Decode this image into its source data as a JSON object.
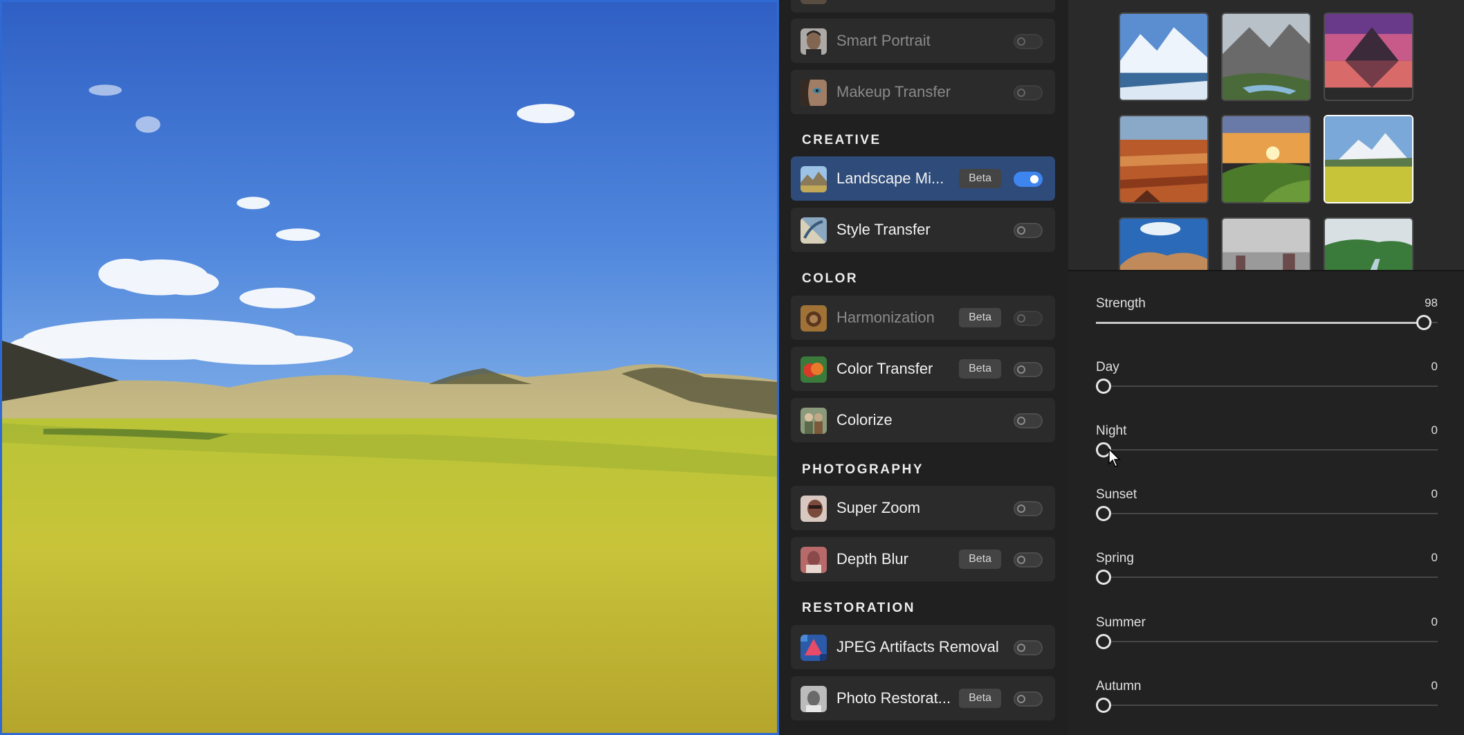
{
  "sections": {
    "creative": "CREATIVE",
    "color": "COLOR",
    "photography": "PHOTOGRAPHY",
    "restoration": "RESTORATION"
  },
  "filters": {
    "top_partial": {
      "label": "",
      "enabled": false
    },
    "smart_portrait": {
      "label": "Smart Portrait",
      "enabled": false
    },
    "makeup_transfer": {
      "label": "Makeup Transfer",
      "enabled": false
    },
    "landscape_mixer": {
      "label": "Landscape Mi...",
      "badge": "Beta",
      "enabled": true
    },
    "style_transfer": {
      "label": "Style Transfer",
      "enabled": false
    },
    "harmonization": {
      "label": "Harmonization",
      "badge": "Beta",
      "enabled": false
    },
    "color_transfer": {
      "label": "Color Transfer",
      "badge": "Beta",
      "enabled": false
    },
    "colorize": {
      "label": "Colorize",
      "enabled": false
    },
    "super_zoom": {
      "label": "Super Zoom",
      "enabled": false
    },
    "depth_blur": {
      "label": "Depth Blur",
      "badge": "Beta",
      "enabled": false
    },
    "jpeg_artifacts_removal": {
      "label": "JPEG Artifacts Removal",
      "enabled": false
    },
    "photo_restoration": {
      "label": "Photo Restorat...",
      "badge": "Beta",
      "enabled": false
    }
  },
  "gallery": {
    "selected_index": 5,
    "thumbnails": [
      "snowy-lake",
      "mountain-valley",
      "matterhorn-sunset",
      "canyon",
      "sunset-hills",
      "green-meadow-mountains",
      "rock-cliffs",
      "misty-rocks",
      "river-valley"
    ]
  },
  "sliders": {
    "strength": {
      "label": "Strength",
      "value": "98",
      "fraction": 0.98
    },
    "day": {
      "label": "Day",
      "value": "0",
      "fraction": 0
    },
    "night": {
      "label": "Night",
      "value": "0",
      "fraction": 0
    },
    "sunset": {
      "label": "Sunset",
      "value": "0",
      "fraction": 0
    },
    "spring": {
      "label": "Spring",
      "value": "0",
      "fraction": 0
    },
    "summer": {
      "label": "Summer",
      "value": "0",
      "fraction": 0
    },
    "autumn": {
      "label": "Autumn",
      "value": "0",
      "fraction": 0
    }
  },
  "colors": {
    "accent": "#3f85f0",
    "active_row": "#2e4b7a",
    "panel": "#202020"
  }
}
